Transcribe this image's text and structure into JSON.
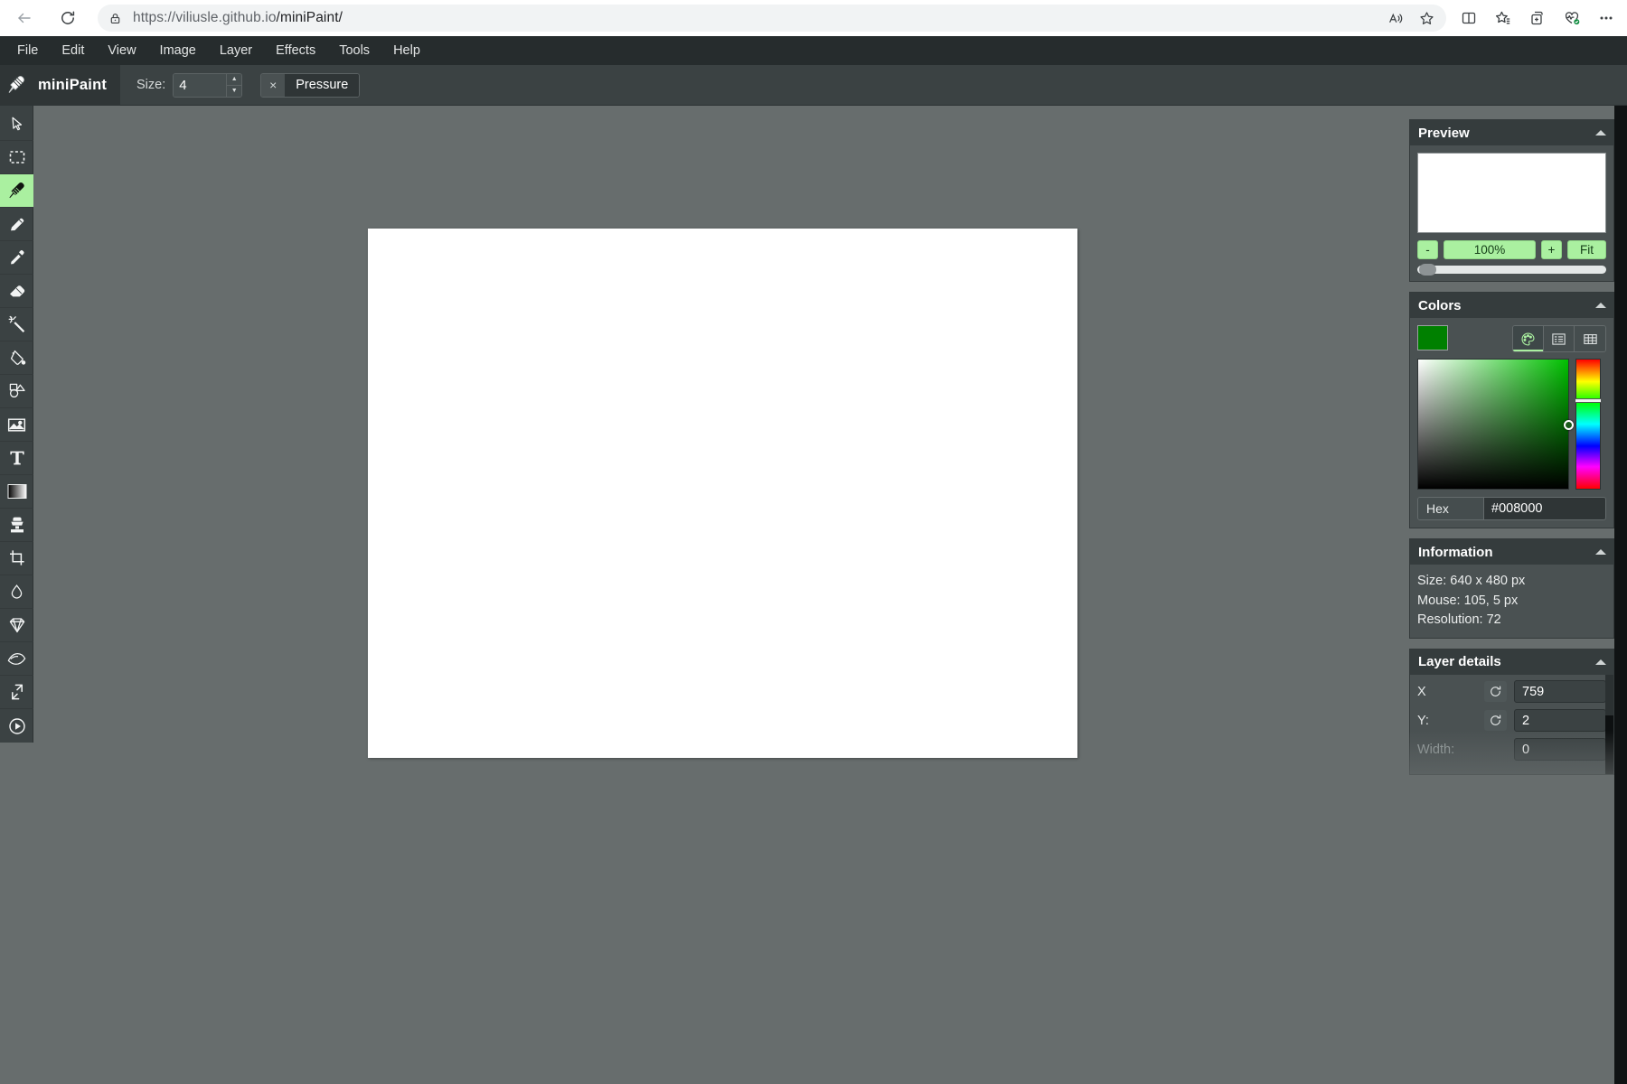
{
  "browser": {
    "url_prefix": "https://viliusle.github.io",
    "url_suffix": "/miniPaint/",
    "back_icon": "back-arrow-icon",
    "reload_icon": "reload-icon",
    "lock_icon": "lock-icon",
    "right_icons": [
      {
        "name": "read-aloud-icon"
      },
      {
        "name": "favorite-star-icon"
      },
      {
        "name": "split-screen-icon"
      },
      {
        "name": "collections-icon"
      },
      {
        "name": "add-to-favorites-icon"
      },
      {
        "name": "browser-essentials-icon"
      },
      {
        "name": "settings-more-icon"
      }
    ]
  },
  "menu": {
    "items": [
      "File",
      "Edit",
      "View",
      "Image",
      "Layer",
      "Effects",
      "Tools",
      "Help"
    ]
  },
  "header": {
    "logo_icon": "paintbrush-logo-icon",
    "title": "miniPaint",
    "size_label": "Size:",
    "size_value": "4",
    "pressure_checkbox": "×",
    "pressure_label": "Pressure"
  },
  "tools": [
    {
      "name": "select-tool",
      "icon": "cursor-arrow-icon",
      "active": false
    },
    {
      "name": "marquee-selection-tool",
      "icon": "dashed-rectangle-icon",
      "active": false
    },
    {
      "name": "brush-tool",
      "icon": "paintbrush-icon",
      "active": true
    },
    {
      "name": "pencil-tool",
      "icon": "pencil-icon",
      "active": false
    },
    {
      "name": "color-picker-tool",
      "icon": "eyedropper-icon",
      "active": false
    },
    {
      "name": "eraser-tool",
      "icon": "eraser-icon",
      "active": false
    },
    {
      "name": "magic-wand-tool",
      "icon": "magic-wand-icon",
      "active": false
    },
    {
      "name": "fill-tool",
      "icon": "paint-bucket-icon",
      "active": false
    },
    {
      "name": "shape-tool",
      "icon": "shapes-icon",
      "active": false
    },
    {
      "name": "media-tool",
      "icon": "image-icon",
      "active": false
    },
    {
      "name": "text-tool",
      "icon": "text-t-icon",
      "active": false
    },
    {
      "name": "gradient-tool",
      "icon": "gradient-icon",
      "active": false
    },
    {
      "name": "clone-tool",
      "icon": "clone-stamp-icon",
      "active": false
    },
    {
      "name": "crop-tool",
      "icon": "crop-icon",
      "active": false
    },
    {
      "name": "blur-tool",
      "icon": "water-drop-icon",
      "active": false
    },
    {
      "name": "sharpen-tool",
      "icon": "diamond-icon",
      "active": false
    },
    {
      "name": "bulge-pinch-tool",
      "icon": "bulge-pinch-icon",
      "active": false
    },
    {
      "name": "resize-tool",
      "icon": "resize-arrows-icon",
      "active": false
    },
    {
      "name": "animation-tool",
      "icon": "play-circle-icon",
      "active": false
    }
  ],
  "preview": {
    "title": "Preview",
    "collapse_icon": "caret-up-icon",
    "zoom_out": "-",
    "zoom_level": "100%",
    "zoom_in": "+",
    "fit": "Fit"
  },
  "colors": {
    "title": "Colors",
    "collapse_icon": "caret-up-icon",
    "current_color": "#008000",
    "modes": [
      {
        "name": "palette-mode-button",
        "icon": "palette-icon",
        "active": true
      },
      {
        "name": "list-mode-button",
        "icon": "list-icon",
        "active": false
      },
      {
        "name": "grid-mode-button",
        "icon": "grid-icon",
        "active": false
      }
    ],
    "hex_label": "Hex",
    "hex_value": "#008000"
  },
  "information": {
    "title": "Information",
    "collapse_icon": "caret-up-icon",
    "lines": [
      "Size: 640 x 480 px",
      "Mouse: 105, 5 px",
      "Resolution: 72"
    ]
  },
  "layer_details": {
    "title": "Layer details",
    "collapse_icon": "caret-up-icon",
    "rows": [
      {
        "label": "X",
        "value": "759",
        "reset_icon": "refresh-icon",
        "dim": false
      },
      {
        "label": "Y:",
        "value": "2",
        "reset_icon": "refresh-icon",
        "dim": false
      },
      {
        "label": "Width:",
        "value": "0",
        "reset_icon": "",
        "dim": true
      }
    ]
  }
}
